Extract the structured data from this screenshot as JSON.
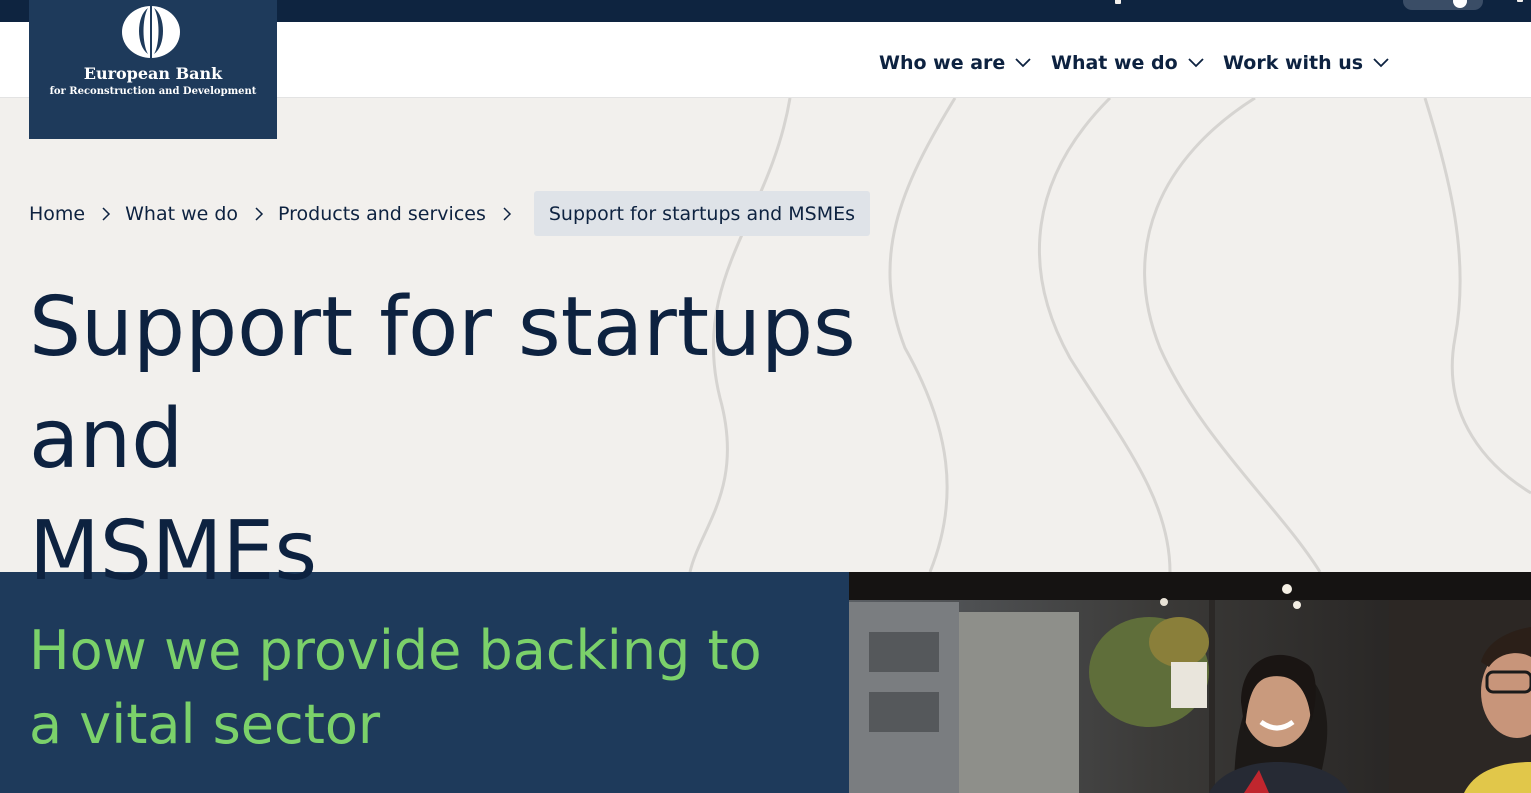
{
  "logo": {
    "title": "European Bank",
    "subtitle": "for Reconstruction and Development"
  },
  "nav": {
    "items": [
      {
        "label": "Who we are"
      },
      {
        "label": "What we do"
      },
      {
        "label": "Work with us"
      }
    ]
  },
  "breadcrumb": {
    "items": [
      {
        "label": "Home"
      },
      {
        "label": "What we do"
      },
      {
        "label": "Products and services"
      }
    ],
    "current": "Support for startups and MSMEs"
  },
  "page": {
    "title_line1": "Support for startups and",
    "title_line2": "MSMEs"
  },
  "section": {
    "title_line1": "How we provide backing to",
    "title_line2": "a vital sector"
  },
  "colors": {
    "brand_navy": "#1e3a5b",
    "topbar": "#0e2440",
    "accent_green": "#7bd16a",
    "hero_bg": "#f2f0ed"
  },
  "icons": {
    "nav_chevron": "chevron-down-icon",
    "breadcrumb_separator": "chevron-right-icon",
    "logo": "ebrd-logo-icon"
  }
}
